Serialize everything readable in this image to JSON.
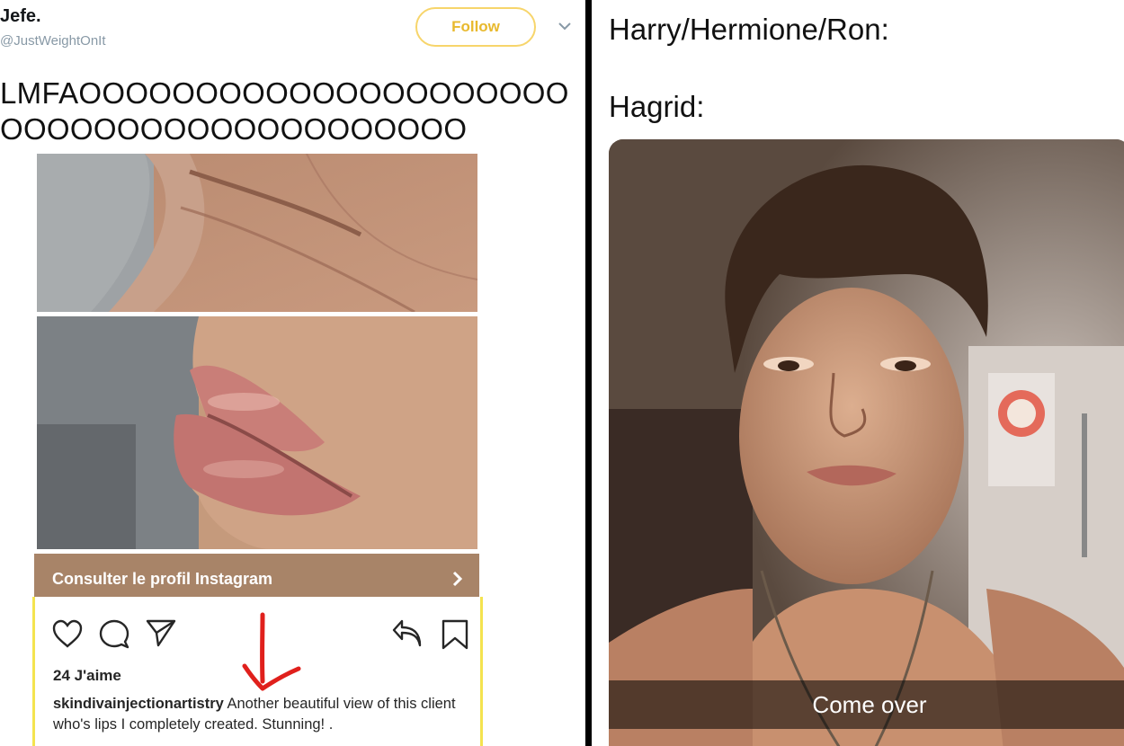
{
  "tweet": {
    "display_name": "Jefe.",
    "handle": "@JustWeightOnIt",
    "follow_label": "Follow",
    "text": "LMFAOOOOOOOOOOOOOOOOOOOOOOOOOOOOOOOOOOOOOOOOO"
  },
  "instagram_embed": {
    "profile_link_label": "Consulter le profil Instagram",
    "likes": "24 J'aime",
    "caption_user": "skindivainjectionartistry",
    "caption_text": " Another beautiful view of this client who's lips I completely created. Stunning! ."
  },
  "meme": {
    "line1": "Harry/Hermione/Ron:",
    "line2": "Hagrid:",
    "snap_caption": "Come over"
  },
  "icons": {
    "follow_menu": "chevron-down-icon",
    "profile_link": "chevron-right-icon",
    "like": "heart-icon",
    "comment": "comment-icon",
    "share": "send-icon",
    "reply": "reply-icon",
    "save": "bookmark-icon",
    "annotation": "red-arrow-icon"
  },
  "colors": {
    "follow_accent": "#e8b92e",
    "profile_bar": "#a88468",
    "embed_border": "#f4e34f",
    "annotation": "#e0201c"
  }
}
